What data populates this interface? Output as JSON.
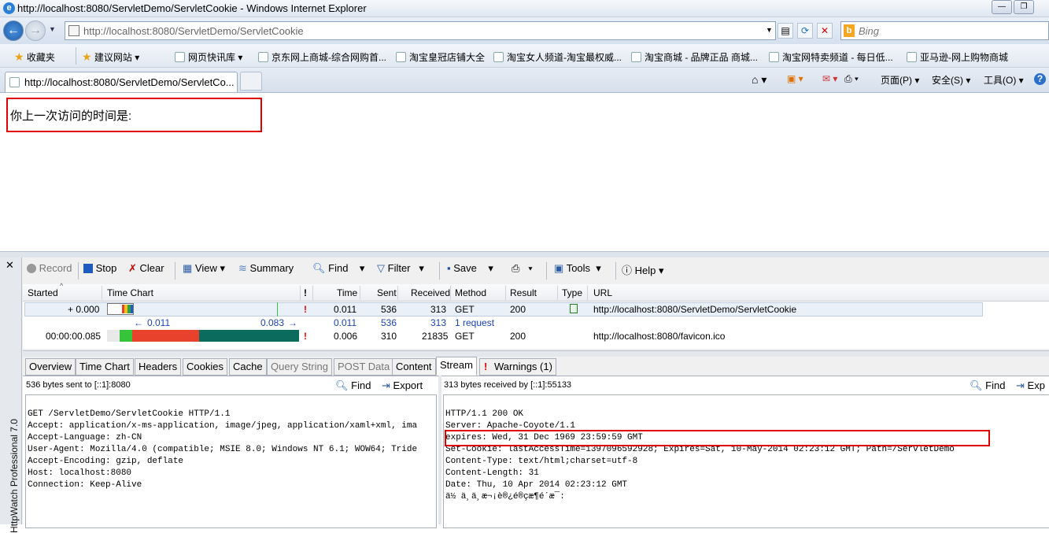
{
  "window": {
    "title": "http://localhost:8080/ServletDemo/ServletCookie - Windows Internet Explorer"
  },
  "address": {
    "url": "http://localhost:8080/ServletDemo/ServletCookie",
    "search_placeholder": "Bing"
  },
  "favorites": {
    "label": "收藏夹",
    "items": [
      "建议网站 ▾",
      "网页快讯库 ▾",
      "京东网上商城-综合网购首...",
      "淘宝皇冠店铺大全",
      "淘宝女人频道-淘宝最权威...",
      "淘宝商城 - 品牌正品 商城...",
      "淘宝网特卖频道 - 每日低...",
      "亚马逊-网上购物商城"
    ]
  },
  "tab": {
    "title": "http://localhost:8080/ServletDemo/ServletCo..."
  },
  "commandbar": {
    "page": "页面(P) ▾",
    "safety": "安全(S) ▾",
    "tools": "工具(O) ▾"
  },
  "page": {
    "text": "你上一次访问的时间是:"
  },
  "httpwatch": {
    "side_label": "HttpWatch Professional 7.0",
    "toolbar": {
      "record": "Record",
      "stop": "Stop",
      "clear": "Clear",
      "view": "View",
      "summary": "Summary",
      "find": "Find",
      "filter": "Filter",
      "save": "Save",
      "tools": "Tools",
      "help": "Help"
    },
    "columns": [
      "Started",
      "Time Chart",
      "!",
      "Time",
      "Sent",
      "Received",
      "Method",
      "Result",
      "Type",
      "URL"
    ],
    "rows": [
      {
        "started": "+ 0.000",
        "bang": "!",
        "time": "0.011",
        "sent": "536",
        "received": "313",
        "method": "GET",
        "result": "200",
        "url": "http://localhost:8080/ServletDemo/ServletCookie"
      },
      {
        "chart_left": "0.011",
        "chart_right": "0.083",
        "time": "0.011",
        "sent": "536",
        "received": "313",
        "method": "1 request"
      },
      {
        "started": "00:00:00.085",
        "bang": "!",
        "time": "0.006",
        "sent": "310",
        "received": "21835",
        "method": "GET",
        "result": "200",
        "url": "http://localhost:8080/favicon.ico"
      }
    ],
    "detail_tabs": [
      "Overview",
      "Time Chart",
      "Headers",
      "Cookies",
      "Cache",
      "Query String",
      "POST Data",
      "Content",
      "Stream",
      "Warnings (1)"
    ],
    "left_pane": {
      "header": "536 bytes sent to [::1]:8080",
      "find": "Find",
      "export": "Export",
      "lines": [
        "GET /ServletDemo/ServletCookie HTTP/1.1",
        "Accept: application/x-ms-application, image/jpeg, application/xaml+xml, ima",
        "Accept-Language: zh-CN",
        "User-Agent: Mozilla/4.0 (compatible; MSIE 8.0; Windows NT 6.1; WOW64; Tride",
        "Accept-Encoding: gzip, deflate",
        "Host: localhost:8080",
        "Connection: Keep-Alive"
      ]
    },
    "right_pane": {
      "header": "313 bytes received by [::1]:55133",
      "find": "Find",
      "export": "Exp",
      "lines": [
        "HTTP/1.1 200 OK",
        "Server: Apache-Coyote/1.1",
        "expires: Wed, 31 Dec 1969 23:59:59 GMT",
        "Set-Cookie: lastAccessTime=1397096592928; Expires=Sat, 10-May-2014 02:23:12 GMT; Path=/ServletDemo",
        "Content-Type: text/html;charset=utf-8",
        "Content-Length: 31",
        "Date: Thu, 10 Apr 2014 02:23:12 GMT",
        "",
        "ä½ ä¸ä¸æ¬¡è®¿é®çæ¶é´æ¯:"
      ]
    }
  },
  "colors": {
    "highlight": "#e00000",
    "bar_green": "#36c53a",
    "bar_red": "#e8412c",
    "bar_teal": "#0b6b5c"
  }
}
